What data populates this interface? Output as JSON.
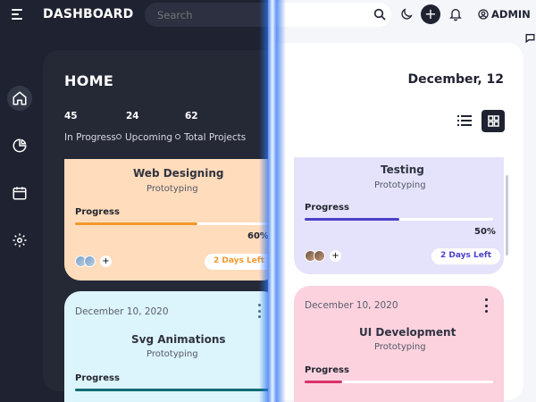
{
  "header": {
    "brand": "DASHBOARD",
    "search_placeholder": "Search",
    "admin_label": "ADMIN"
  },
  "sidenav": {
    "items": [
      {
        "name": "home",
        "icon": "home-icon",
        "active": true
      },
      {
        "name": "analytics",
        "icon": "pie-chart-icon",
        "active": false
      },
      {
        "name": "calendar",
        "icon": "calendar-icon",
        "active": false
      },
      {
        "name": "settings",
        "icon": "gear-icon",
        "active": false
      }
    ]
  },
  "main": {
    "title": "HOME",
    "date": "December, 12",
    "stats": [
      {
        "value": "45",
        "label": "In Progress"
      },
      {
        "value": "24",
        "label": "Upcoming"
      },
      {
        "value": "62",
        "label": "Total Projects"
      }
    ],
    "view_modes": [
      "list-view-icon",
      "grid-view-icon"
    ],
    "active_view": "grid"
  },
  "projects": [
    {
      "title": "Web Designing",
      "subtitle": "Prototyping",
      "progress_label": "Progress",
      "progress_value": 0.6,
      "progress_text": "60%",
      "days_left": "2 Days Left",
      "accent": "#f2992b",
      "card_color": "#ffdcbc"
    },
    {
      "title": "Testing",
      "subtitle": "Prototyping",
      "progress_label": "Progress",
      "progress_value": 0.5,
      "progress_text": "50%",
      "days_left": "2 Days Left",
      "accent": "#4b3fc9",
      "card_color": "#e4e3fb"
    },
    {
      "date": "December 10, 2020",
      "title": "Svg Animations",
      "subtitle": "Prototyping",
      "progress_label": "Progress",
      "accent": "#0d6b74",
      "card_color": "#dcf4fb"
    },
    {
      "date": "December 10, 2020",
      "title": "UI Development",
      "subtitle": "Prototyping",
      "progress_label": "Progress",
      "accent": "#d9316a",
      "card_color": "#fcd2df"
    }
  ],
  "colors": {
    "dark_bg": "#1f2230",
    "dark_panel": "#252936",
    "light_bg": "#f5f6fa",
    "light_panel": "#ffffff"
  }
}
